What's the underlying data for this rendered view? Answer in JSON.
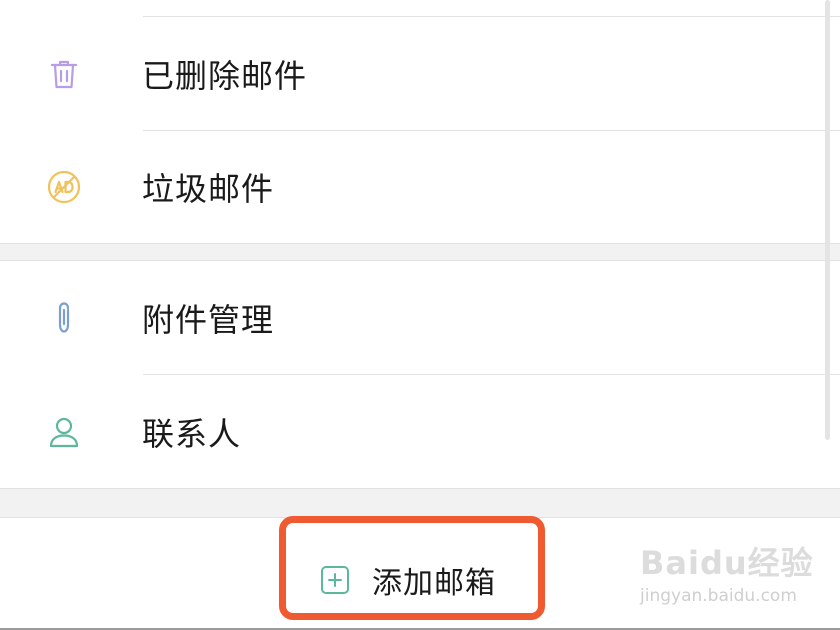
{
  "menu": {
    "items": [
      {
        "label": "已删除邮件",
        "icon": "trash-icon",
        "color": "#b79ce6"
      },
      {
        "label": "垃圾邮件",
        "icon": "spam-ad-icon",
        "color": "#f2c25a"
      },
      {
        "label": "附件管理",
        "icon": "paperclip-icon",
        "color": "#7a9fd0"
      },
      {
        "label": "联系人",
        "icon": "contact-person-icon",
        "color": "#5cb89c"
      }
    ]
  },
  "bottom_bar": {
    "add_mailbox_label": "添加邮箱",
    "add_icon": "plus-square-icon",
    "add_icon_color": "#5cb89c",
    "highlight_color": "#ef5a30"
  },
  "watermark": {
    "logo_text": "Baidu经验",
    "url": "jingyan.baidu.com"
  }
}
